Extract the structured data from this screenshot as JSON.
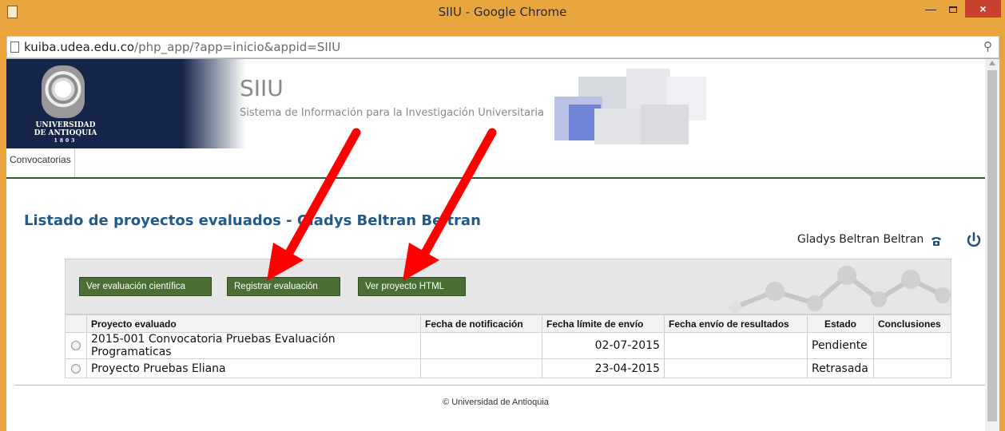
{
  "window": {
    "title": "SIIU - Google Chrome",
    "close_label": "×"
  },
  "address": {
    "host": "kuiba.udea.edu.co",
    "path": "/php_app/?app=inicio&appid=SIIU"
  },
  "banner": {
    "university_line1": "UNIVERSIDAD",
    "university_line2": "DE ANTIOQUIA",
    "university_year": "1803",
    "app_name": "SIIU",
    "app_subtitle": "Sistema de Información para la Investigación Universitaria"
  },
  "menu": {
    "items": [
      "Convocatorias"
    ]
  },
  "page": {
    "heading": "Listado de proyectos evaluados - Gladys Beltran Beltran",
    "user_name": "Gladys Beltran Beltran",
    "footer": "© Universidad de Antioquia"
  },
  "buttons": {
    "ver_cientifica": "Ver evaluación científica",
    "registrar": "Registrar evaluación",
    "ver_html": "Ver proyecto HTML"
  },
  "table": {
    "headers": [
      "",
      "Proyecto evaluado",
      "Fecha de notificación",
      "Fecha límite de envío",
      "Fecha envío de resultados",
      "Estado",
      "Conclusiones"
    ],
    "rows": [
      {
        "proyecto": "2015-001 Convocatoria Pruebas Evaluación Programaticas",
        "notificacion": "",
        "limite": "02-07-2015",
        "envio": "",
        "estado": "Pendiente",
        "conclusiones": ""
      },
      {
        "proyecto": "Proyecto Pruebas Eliana",
        "notificacion": "",
        "limite": "23-04-2015",
        "envio": "",
        "estado": "Retrasada",
        "conclusiones": ""
      }
    ]
  },
  "colors": {
    "titlebar": "#e9a63f",
    "heading": "#1f5a8a",
    "button": "#4a6e34",
    "annotation_arrow": "#ff0000",
    "banner_blue": "#15254a"
  }
}
